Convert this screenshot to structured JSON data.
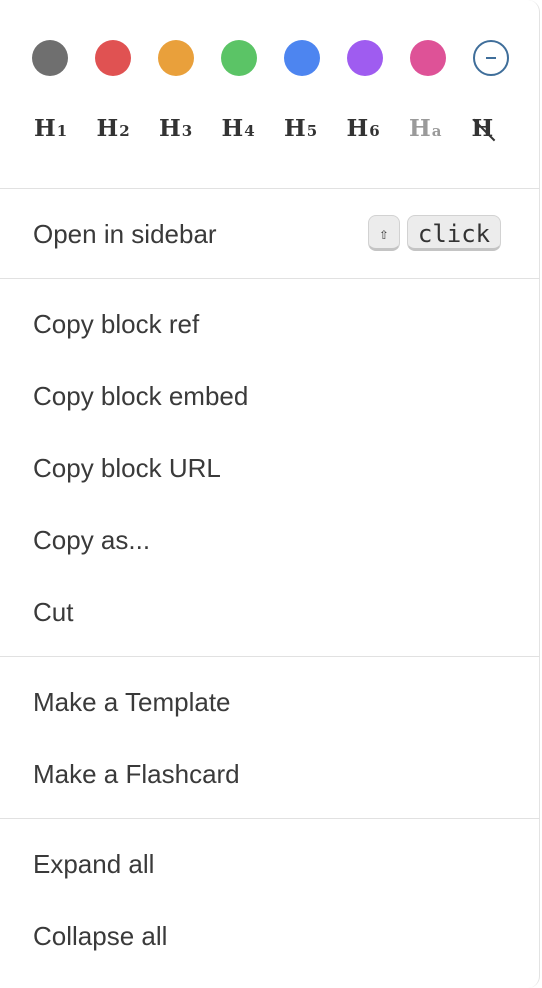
{
  "colors": [
    {
      "name": "gray",
      "hex": "#6f6f6f"
    },
    {
      "name": "red",
      "hex": "#e05252"
    },
    {
      "name": "orange",
      "hex": "#e9a03b"
    },
    {
      "name": "green",
      "hex": "#5bc466"
    },
    {
      "name": "blue",
      "hex": "#4d85f0"
    },
    {
      "name": "purple",
      "hex": "#9f5cf0"
    },
    {
      "name": "pink",
      "hex": "#de5297"
    },
    {
      "name": "none",
      "hex": "#3f6e9a",
      "icon": "minus-circle-icon"
    }
  ],
  "headings": [
    {
      "label": "H",
      "sub": "1"
    },
    {
      "label": "H",
      "sub": "2"
    },
    {
      "label": "H",
      "sub": "3"
    },
    {
      "label": "H",
      "sub": "4"
    },
    {
      "label": "H",
      "sub": "5"
    },
    {
      "label": "H",
      "sub": "6"
    },
    {
      "label": "H",
      "sub": "a",
      "muted": true
    },
    {
      "label": "H",
      "icon": "no-heading-icon"
    }
  ],
  "sidebar": {
    "label": "Open in sidebar",
    "shortcut": [
      "⇧",
      "click"
    ]
  },
  "copy_section": {
    "items": [
      "Copy block ref",
      "Copy block embed",
      "Copy block URL",
      "Copy as...",
      "Cut"
    ]
  },
  "make_section": {
    "items": [
      "Make a Template",
      "Make a Flashcard"
    ]
  },
  "expand_section": {
    "items": [
      "Expand all",
      "Collapse all"
    ]
  }
}
